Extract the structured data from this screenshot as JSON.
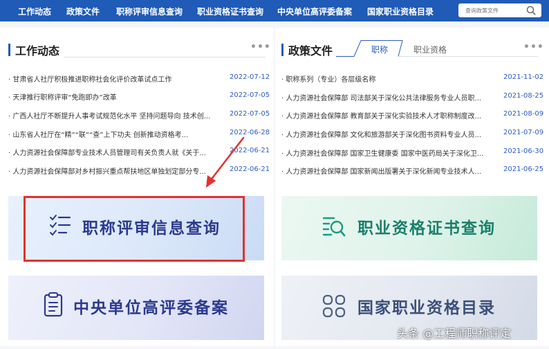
{
  "nav": {
    "items": [
      "工作动态",
      "政策文件",
      "职称评审信息查询",
      "职业资格证书查询",
      "中央单位高评委备案",
      "国家职业资格目录"
    ],
    "search_placeholder": "查询政策文件"
  },
  "left": {
    "title": "工作动态",
    "news": [
      {
        "text": "· 甘肃省人社厅积极推进职称社会化评价改革试点工作",
        "date": "2022-07-12"
      },
      {
        "text": "· 天津推行职称评审“免跑即办”改革",
        "date": "2022-07-05"
      },
      {
        "text": "· 广西人社厅不断提升人事考试规范化水平 坚持问题导向 技术创...",
        "date": "2022-07-05"
      },
      {
        "text": "· 山东省人社厅在“精”“联”“查”上下功夫 创新推动资格考...",
        "date": "2022-06-28"
      },
      {
        "text": "· 人力资源社会保障部专业技术人员管理司有关负责人就《关于...",
        "date": "2022-06-21"
      },
      {
        "text": "· 人力资源社会保障部对乡村振兴重点帮扶地区单独划定部分专...",
        "date": "2022-06-21"
      }
    ]
  },
  "right": {
    "title": "政策文件",
    "tabs": [
      "职称",
      "职业资格"
    ],
    "news": [
      {
        "text": "· 职称系列（专业）各层级名称",
        "date": "2021-11-02"
      },
      {
        "text": "· 人力资源社会保障部 司法部关于深化公共法律服务专业人员职...",
        "date": "2021-08-25"
      },
      {
        "text": "· 人力资源社会保障部 教育部关于深化实验技术人才职称制度改...",
        "date": "2021-08-09"
      },
      {
        "text": "· 人力资源社会保障部 文化和旅游部关于深化图书资料专业人员...",
        "date": "2021-07-09"
      },
      {
        "text": "· 人力资源社会保障部 国家卫生健康委 国家中医药局关于深化卫...",
        "date": "2021-06-30"
      },
      {
        "text": "· 人力资源社会保障部 国家新闻出版署关于深化新闻专业技术人...",
        "date": "2021-06-25"
      }
    ]
  },
  "cards": {
    "title_query": "职称评审信息查询",
    "cert_query": "职业资格证书查询",
    "central_filing": "中央单位高评委备案",
    "catalog": "国家职业资格目录"
  },
  "watermark": "头条 @工程师职称评定",
  "colors": {
    "brand": "#1f5bb7",
    "date": "#2a5cc4",
    "red": "#e1322f",
    "green": "#1a9c80",
    "navy": "#2b3a8f"
  }
}
